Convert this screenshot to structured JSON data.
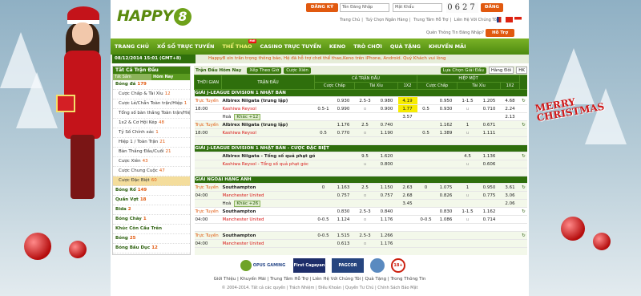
{
  "header": {
    "logo_text": "HAPPY",
    "logo_num": "8",
    "register": "ĐĂNG KÝ",
    "username_ph": "Tên Đăng Nhập",
    "password_ph": "Mật Khẩu",
    "captcha": "0627",
    "login": "ĐĂNG NHẬP",
    "links": [
      "Trang Chủ",
      "Tuỳ Chọn Ngân Hàng",
      "Trung Tâm Hỗ Trợ",
      "Liên Hệ Với Chúng Tôi"
    ],
    "forgot": "Quên Thông Tin Đăng Nhập?",
    "support": "Hỗ Trợ"
  },
  "nav": [
    "TRANG CHỦ",
    "XỔ SỐ TRỰC TUYẾN",
    "THỂ THAO",
    "CASINO TRỰC TUYẾN",
    "KENO",
    "TRÒ CHƠI",
    "QUÀ TẶNG",
    "KHUYẾN MÃI"
  ],
  "nav_new": "Mới",
  "subbar": {
    "date": "08/12/2014 15:01 (GMT+8)",
    "marquee": "Happy8 xin trân trọng thông báo, Hệ đã hỗ trợ chơi thể thao,Keno trên iPhone, Android. Quý Khách vui lòng"
  },
  "sidebar": {
    "title": "Tất Cả Trận Đấu",
    "tab1": "Tất Sắm",
    "tab2": "Hôm Nay",
    "items": [
      {
        "label": "Bóng đá",
        "n": "179",
        "type": "sec"
      },
      {
        "label": "Cược Chấp & Tài Xỉu",
        "n": "12",
        "type": "ind"
      },
      {
        "label": "Cược Lẻ/Chẵn Toàn trận/Hiệp",
        "n": "1",
        "type": "ind"
      },
      {
        "label": "Tổng số bàn thắng Toàn trận/Hiệp",
        "n": "1",
        "type": "ind"
      },
      {
        "label": "1x2 & Cơ Hội Kép",
        "n": "48",
        "type": "ind"
      },
      {
        "label": "Tỷ Số Chính xác",
        "n": "1",
        "type": "ind"
      },
      {
        "label": "Hiệp 1 / Toàn Trận",
        "n": "21",
        "type": "ind"
      },
      {
        "label": "Bàn Thắng Đầu/Cuối",
        "n": "21",
        "type": "ind"
      },
      {
        "label": "Cược Xiên",
        "n": "43",
        "type": "ind"
      },
      {
        "label": "Cược Chung Cuộc",
        "n": "47",
        "type": "ind"
      },
      {
        "label": "Cược Đặc Biệt",
        "n": "60",
        "type": "ind sel"
      },
      {
        "label": "Bóng Rổ",
        "n": "149",
        "type": "sec"
      },
      {
        "label": "Quần Vợt",
        "n": "18",
        "type": "sec"
      },
      {
        "label": "Bida",
        "n": "2",
        "type": "sec"
      },
      {
        "label": "Bóng Chày",
        "n": "1",
        "type": "sec"
      },
      {
        "label": "Khúc Côn Cầu Trên",
        "n": "",
        "type": "sec"
      },
      {
        "label": "Bóng",
        "n": "25",
        "type": "sec"
      },
      {
        "label": "Bóng Bầu Dục",
        "n": "12",
        "type": "sec"
      }
    ]
  },
  "main": {
    "title": "Trận Đấu Hôm Nay",
    "btn_sort": "Xếp Theo Giờ",
    "btn_parlay": "Cược Xiên",
    "btn_choose": "Lựa Chọn Giải Đấu",
    "sel1": "Hàng Đôi",
    "sel2": "HK",
    "headers": {
      "time": "THỜI GIAN",
      "match": "TRẬN ĐẤU",
      "full": "CẢ TRẬN ĐẤU",
      "half": "HIỆP MỘT",
      "hdp": "Cược Chấp",
      "ou": "Tài Xỉu",
      "x12": "1X2"
    }
  },
  "rows": [
    {
      "league": "GIẢI J-LEAGUE DIVISION 1 NHẬT BẢN"
    },
    {
      "time1": "Trực Tuyến",
      "time2": "18:00",
      "home": "Albirex Niigata (trung lập)",
      "away": "Kashiwa Reysol",
      "draw": "Hoà",
      "c": [
        "",
        "0.930",
        "2.5-3",
        "0.980",
        "4.19",
        "",
        "0.950",
        "1-1.5",
        "1.205",
        "4.68"
      ],
      "d": [
        "0.5-1",
        "0.990",
        "o",
        "0.900",
        "1.77",
        "0.5",
        "0.930",
        "u",
        "0.710",
        "2.24"
      ],
      "e": [
        "",
        "",
        "",
        "",
        "3.57",
        "",
        "",
        "",
        "",
        "2.13"
      ],
      "extra": "Khác +12"
    },
    {
      "time1": "Trực Tuyến",
      "time2": "18:00",
      "home": "Albirex Niigata (trung lập)",
      "away": "Kashiwa Reysol",
      "draw": "",
      "c": [
        "",
        "1.176",
        "2.5",
        "0.740",
        "",
        "",
        "1.162",
        "1",
        "0.671",
        ""
      ],
      "d": [
        "0.5",
        "0.770",
        "o",
        "1.190",
        "",
        "0.5",
        "1.389",
        "u",
        "1.111",
        ""
      ],
      "e": [
        "",
        "",
        "",
        "",
        "",
        "",
        "",
        "",
        "",
        ""
      ],
      "extra": ""
    },
    {
      "league": "GIẢI J-LEAGUE DIVISION 1 NHẬT BẢN - CƯỢC ĐẶC BIỆT"
    },
    {
      "time1": "",
      "time2": "",
      "home": "Albirex Niigata - Tổng số quả phạt góc (trung lập)",
      "away": "Kashiwa Reysol - Tổng số quả phạt góc",
      "draw": "",
      "c": [
        "",
        "",
        "9.5",
        "1.620",
        "",
        "",
        "",
        "4.5",
        "1.136",
        ""
      ],
      "d": [
        "",
        "",
        "u",
        "0.800",
        "",
        "",
        "",
        "u",
        "0.606",
        ""
      ],
      "e": [
        "",
        "",
        "",
        "",
        "",
        "",
        "",
        "",
        "",
        ""
      ],
      "extra": ""
    },
    {
      "league": "GIẢI NGOẠI HẠNG ANH"
    },
    {
      "time1": "Trực Tuyến",
      "time2": "04:00",
      "home": "Southampton",
      "away": "Manchester United",
      "draw": "Hoà",
      "c": [
        "0",
        "1.163",
        "2.5",
        "1.150",
        "2.63",
        "0",
        "1.075",
        "1",
        "0.950",
        "3.61"
      ],
      "d": [
        "",
        "0.757",
        "o",
        "0.757",
        "2.68",
        "",
        "0.826",
        "u",
        "0.775",
        "3.06"
      ],
      "e": [
        "",
        "",
        "",
        "",
        "3.45",
        "",
        "",
        "",
        "",
        "2.06"
      ],
      "extra": "Khác +26"
    },
    {
      "time1": "Trực Tuyến",
      "time2": "04:00",
      "home": "Southampton",
      "away": "Manchester United",
      "draw": "",
      "c": [
        "",
        "0.830",
        "2.5-3",
        "0.840",
        "",
        "",
        "0.830",
        "1-1.5",
        "1.162",
        ""
      ],
      "d": [
        "0-0.5",
        "1.124",
        "o",
        "1.176",
        "",
        "0-0.5",
        "1.086",
        "u",
        "0.714",
        ""
      ],
      "e": [
        "",
        "",
        "",
        "",
        "",
        "",
        "",
        "",
        "",
        ""
      ],
      "extra": ""
    },
    {
      "time1": "Trực Tuyến",
      "time2": "04:00",
      "home": "Southampton",
      "away": "Manchester United",
      "draw": "",
      "c": [
        "0-0.5",
        "1.515",
        "2.5-3",
        "1.266",
        "",
        "",
        "",
        "",
        "",
        ""
      ],
      "d": [
        "",
        "0.613",
        "o",
        "1.176",
        "",
        "",
        "",
        "",
        "",
        ""
      ],
      "e": [
        "",
        "",
        "",
        "",
        "",
        "",
        "",
        "",
        "",
        ""
      ],
      "extra": ""
    },
    {
      "league": "GIẢI NGOẠI HẠNG ANH - Thời gian bù giờ cuối hiệp 1"
    },
    {
      "time1": "09/12",
      "time2": "04:00",
      "home": "Southampton",
      "away": "Manchester United",
      "draw": "",
      "c": [
        "",
        "",
        "1.5",
        "0.650",
        "",
        "",
        "",
        "",
        "",
        ""
      ],
      "d": [
        "",
        "",
        "u",
        "1.176",
        "",
        "",
        "",
        "",
        "",
        ""
      ],
      "e": [
        "",
        "",
        "",
        "",
        "",
        "",
        "",
        "",
        "",
        ""
      ],
      "extra": ""
    },
    {
      "league": "GIẢI NGOẠI HẠNG ANH - Thời gian bù giờ cuối hiệp 1"
    }
  ],
  "footer": {
    "logos": [
      "OPUS GAMING",
      "First Cagayan",
      "PAGCOR",
      "18+"
    ],
    "powered": "Powered by",
    "links": [
      "Giới Thiệu",
      "Khuyến Mãi",
      "Trung Tâm Hỗ Trợ",
      "Liên Hệ Với Chúng Tôi",
      "Quà Tặng",
      "Trong Thông Tin"
    ],
    "copy": "© 2004-2014. Tất cả các quyền  |  Trách Nhiệm  |  Điều Khoản  |  Quyền Tư Chủ  |  Chính Sách Bảo Mật"
  },
  "side_text": "MERRY CHRISTMAS"
}
